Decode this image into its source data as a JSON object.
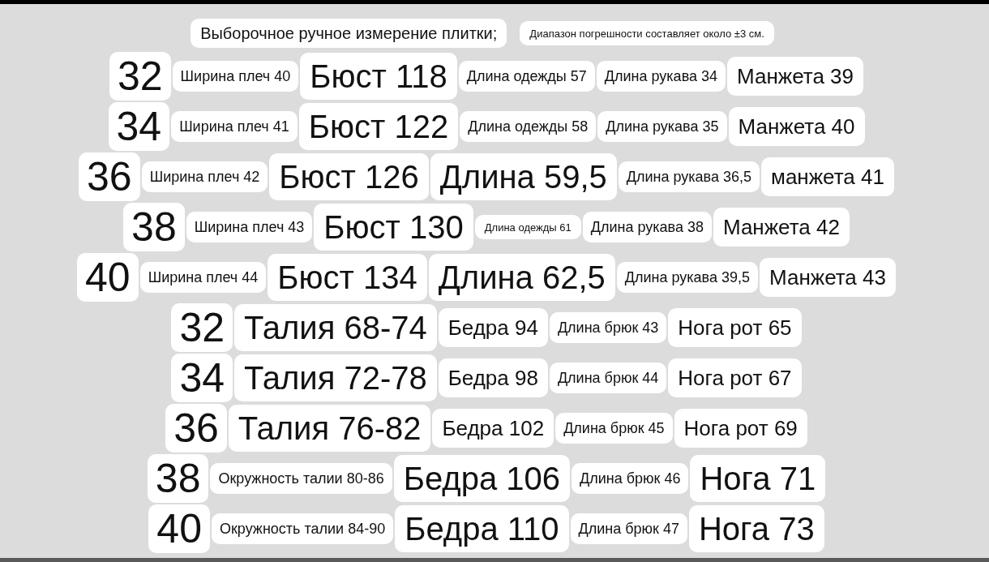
{
  "header": [
    {
      "text": "Выборочное ручное измерение плитки;",
      "kind": "md"
    },
    {
      "text": "Диапазон погрешности составляет около ±3 см.",
      "kind": "xs"
    }
  ],
  "rows": [
    {
      "cells": [
        {
          "text": "32",
          "kind": "xl"
        },
        {
          "text": "Ширина плеч 40",
          "kind": "sm"
        },
        {
          "text": "Бюст 118",
          "kind": "lg"
        },
        {
          "text": "Длина одежды 57",
          "kind": "sm"
        },
        {
          "text": "Длина рукава 34",
          "kind": "sm"
        },
        {
          "text": "Манжета 39",
          "kind": "md"
        }
      ]
    },
    {
      "cells": [
        {
          "text": "34",
          "kind": "xl"
        },
        {
          "text": "Ширина плеч 41",
          "kind": "sm"
        },
        {
          "text": "Бюст 122",
          "kind": "lg"
        },
        {
          "text": "Длина одежды 58",
          "kind": "sm"
        },
        {
          "text": "Длина рукава 35",
          "kind": "sm"
        },
        {
          "text": "Манжета 40",
          "kind": "md"
        }
      ]
    },
    {
      "cells": [
        {
          "text": "36",
          "kind": "xl"
        },
        {
          "text": "Ширина плеч 42",
          "kind": "sm"
        },
        {
          "text": "Бюст 126",
          "kind": "lg"
        },
        {
          "text": "Длина 59,5",
          "kind": "lg"
        },
        {
          "text": "Длина рукава 36,5",
          "kind": "sm"
        },
        {
          "text": "манжета 41",
          "kind": "md"
        }
      ]
    },
    {
      "cells": [
        {
          "text": "38",
          "kind": "xl"
        },
        {
          "text": "Ширина плеч 43",
          "kind": "sm"
        },
        {
          "text": "Бюст 130",
          "kind": "lg"
        },
        {
          "text": "Длина одежды 61",
          "kind": "xs"
        },
        {
          "text": "Длина рукава 38",
          "kind": "sm"
        },
        {
          "text": "Манжета 42",
          "kind": "md"
        }
      ]
    },
    {
      "cells": [
        {
          "text": "40",
          "kind": "xl"
        },
        {
          "text": "Ширина плеч 44",
          "kind": "sm"
        },
        {
          "text": "Бюст 134",
          "kind": "lg"
        },
        {
          "text": "Длина 62,5",
          "kind": "lg"
        },
        {
          "text": "Длина рукава 39,5",
          "kind": "sm"
        },
        {
          "text": "Манжета 43",
          "kind": "md"
        }
      ]
    },
    {
      "cells": [
        {
          "text": "32",
          "kind": "xl"
        },
        {
          "text": "Талия 68-74",
          "kind": "lg"
        },
        {
          "text": "Бедра 94",
          "kind": "md"
        },
        {
          "text": "Длина брюк 43",
          "kind": "sm"
        },
        {
          "text": "Нога рот 65",
          "kind": "md"
        }
      ]
    },
    {
      "cells": [
        {
          "text": "34",
          "kind": "xl"
        },
        {
          "text": "Талия 72-78",
          "kind": "lg"
        },
        {
          "text": "Бедра 98",
          "kind": "md"
        },
        {
          "text": "Длина брюк 44",
          "kind": "sm"
        },
        {
          "text": "Нога рот 67",
          "kind": "md"
        }
      ]
    },
    {
      "cells": [
        {
          "text": "36",
          "kind": "xl"
        },
        {
          "text": "Талия 76-82",
          "kind": "lg"
        },
        {
          "text": "Бедра 102",
          "kind": "md"
        },
        {
          "text": "Длина брюк 45",
          "kind": "sm"
        },
        {
          "text": "Нога рот 69",
          "kind": "md"
        }
      ]
    },
    {
      "cells": [
        {
          "text": "38",
          "kind": "xl"
        },
        {
          "text": "Окружность талии 80-86",
          "kind": "sm"
        },
        {
          "text": "Бедра 106",
          "kind": "lg"
        },
        {
          "text": "Длина брюк 46",
          "kind": "sm"
        },
        {
          "text": "Нога 71",
          "kind": "lg"
        }
      ]
    },
    {
      "cells": [
        {
          "text": "40",
          "kind": "xl"
        },
        {
          "text": "Окружность талии 84-90",
          "kind": "sm"
        },
        {
          "text": "Бедра 110",
          "kind": "lg"
        },
        {
          "text": "Длина брюк 47",
          "kind": "sm"
        },
        {
          "text": "Нога 73",
          "kind": "lg"
        }
      ]
    }
  ]
}
